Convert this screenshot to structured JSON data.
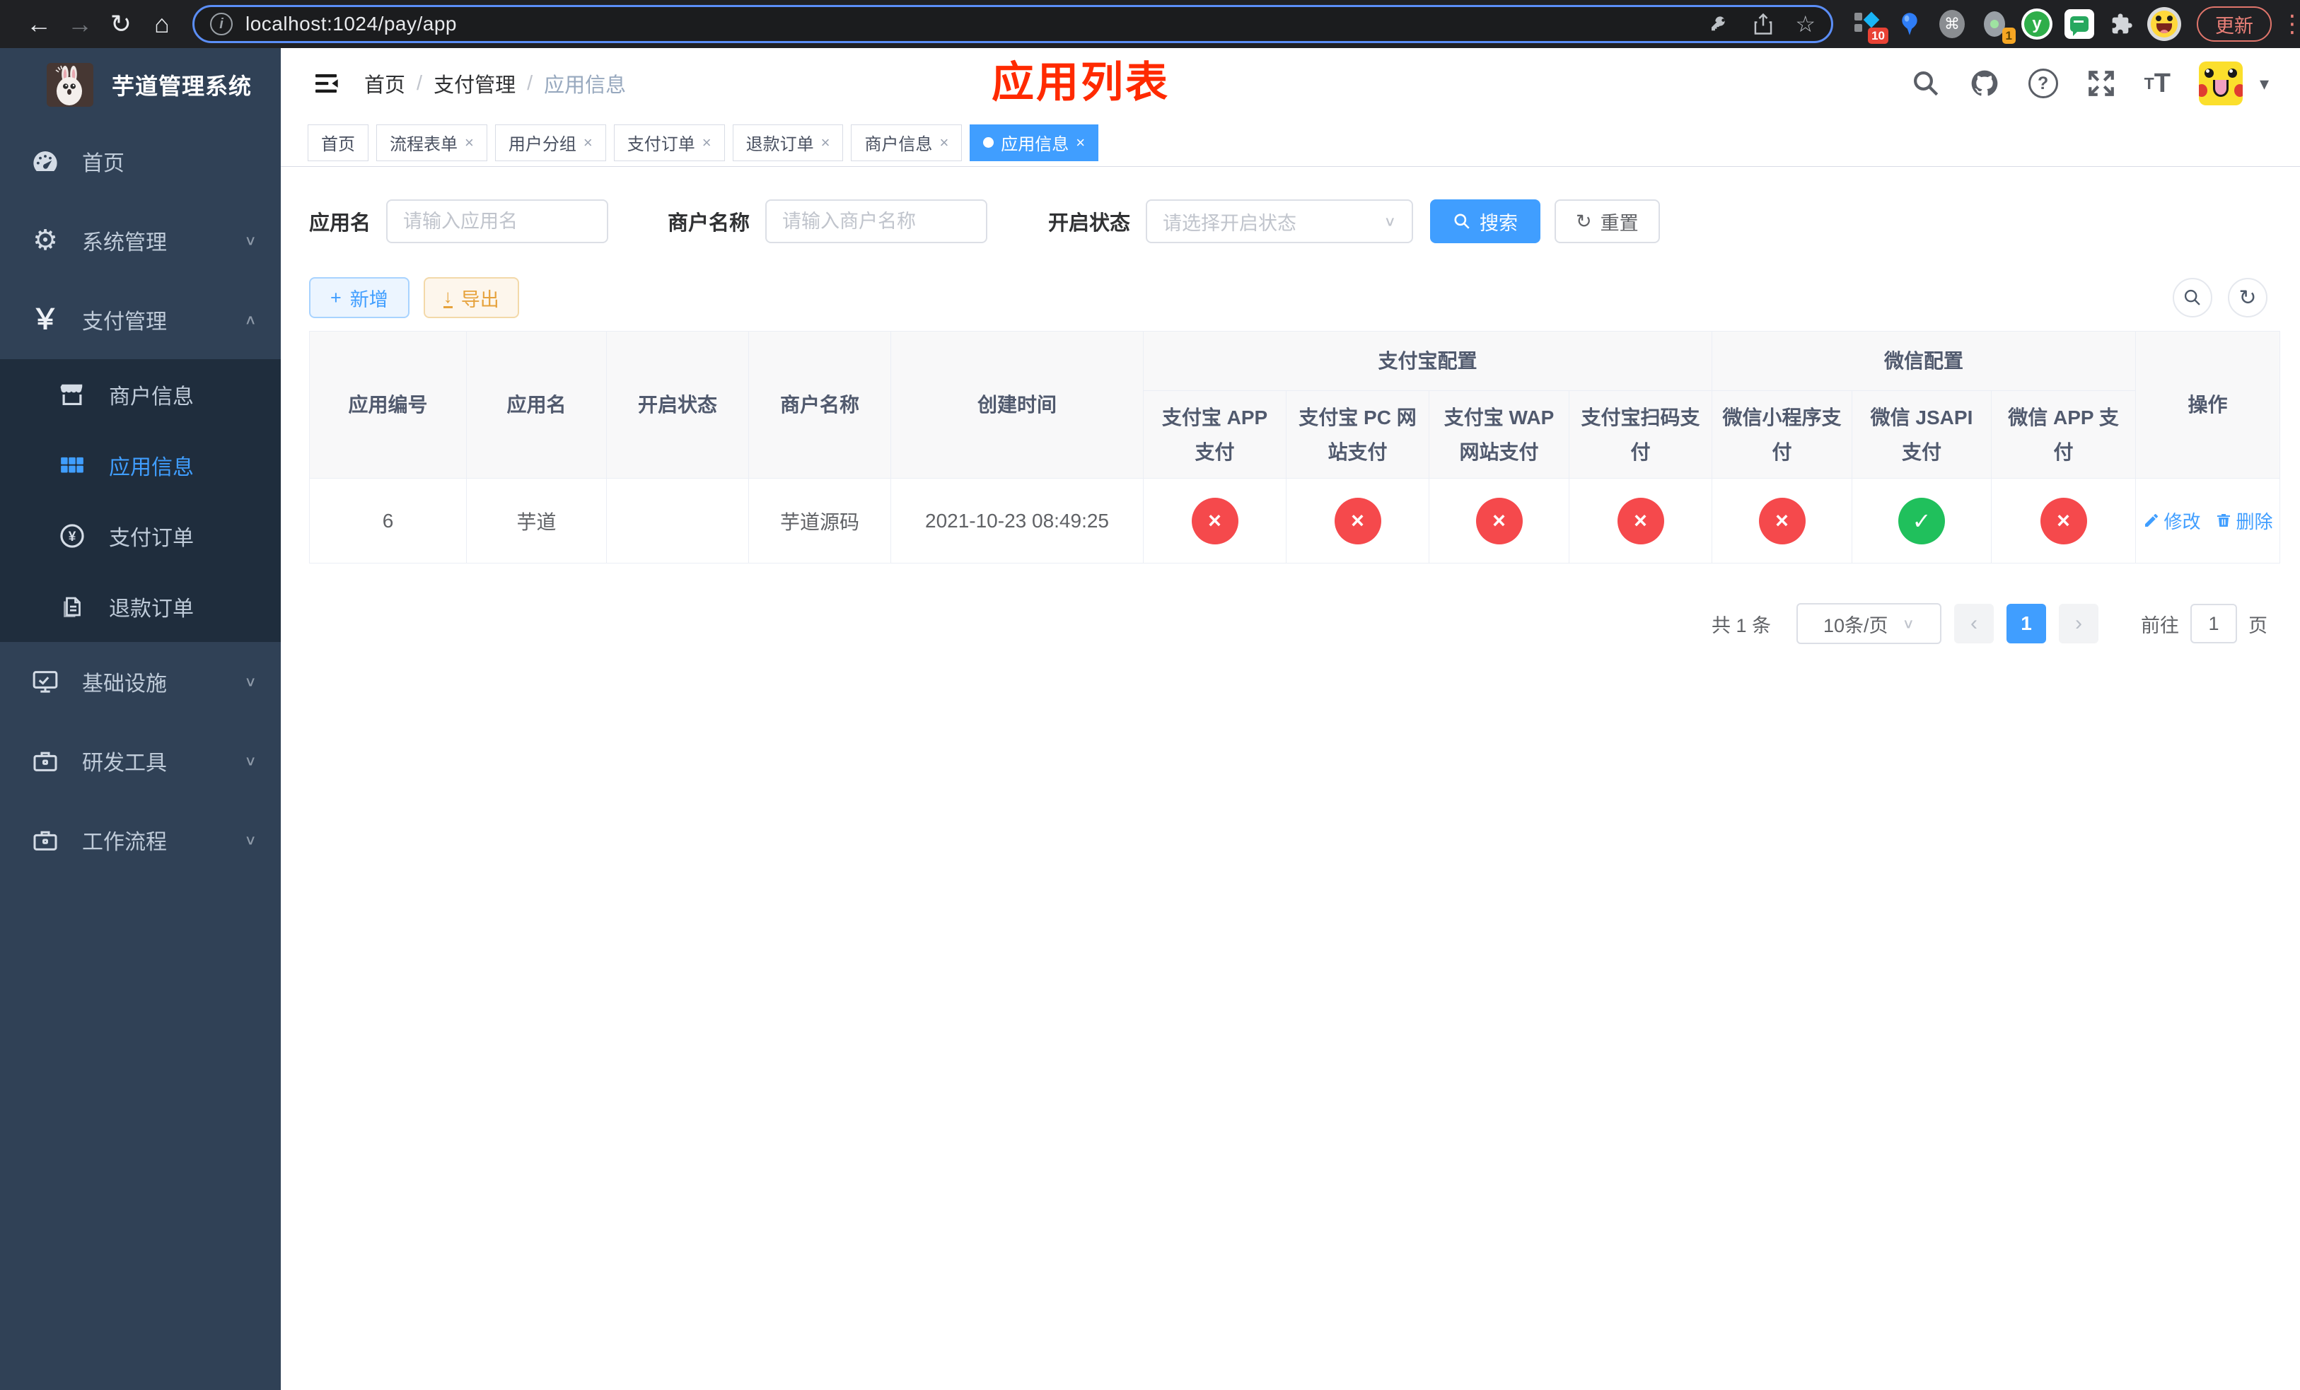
{
  "browser": {
    "url": "localhost:1024/pay/app",
    "update_button": "更新",
    "extension_badges": {
      "first": "10",
      "fourth": "1"
    }
  },
  "icons": {
    "back": "←",
    "forward": "→",
    "reload": "↻",
    "home": "⌂",
    "info": "i",
    "star": "☆",
    "command": "⌘",
    "kebab": "⋮",
    "caret_down": "▾",
    "chevron_down": "∨",
    "chevron_up": "∧",
    "breadcrumb_separator": "/",
    "yuan": "￥",
    "plus": "+",
    "download": "↓",
    "refresh": "↻",
    "check": "✓",
    "cross": "×",
    "page_prev": "‹",
    "page_next": "›",
    "help": "?",
    "font_small": "T",
    "font_large": "T",
    "y_logo": "y",
    "dot": "●"
  },
  "sidebar": {
    "title": "芋道管理系统",
    "items": [
      {
        "label": "首页",
        "icon": "dashboard-icon"
      },
      {
        "label": "系统管理",
        "icon": "gear-icon",
        "state": "collapsed"
      },
      {
        "label": "支付管理",
        "icon": "yuan-icon",
        "state": "expanded"
      },
      {
        "label": "商户信息",
        "icon": "store-icon",
        "submenu": true
      },
      {
        "label": "应用信息",
        "icon": "grid-icon",
        "submenu": true,
        "active": true
      },
      {
        "label": "支付订单",
        "icon": "yuan-circle-icon",
        "submenu": true
      },
      {
        "label": "退款订单",
        "icon": "document-icon",
        "submenu": true
      },
      {
        "label": "基础设施",
        "icon": "monitor-icon",
        "state": "collapsed"
      },
      {
        "label": "研发工具",
        "icon": "briefcase-icon",
        "state": "collapsed"
      },
      {
        "label": "工作流程",
        "icon": "briefcase-icon",
        "state": "collapsed"
      }
    ]
  },
  "header": {
    "breadcrumb": [
      "首页",
      "支付管理",
      "应用信息"
    ],
    "annotation": "应用列表"
  },
  "tabs": [
    {
      "label": "首页",
      "closable": false,
      "active": false
    },
    {
      "label": "流程表单",
      "closable": true,
      "active": false
    },
    {
      "label": "用户分组",
      "closable": true,
      "active": false
    },
    {
      "label": "支付订单",
      "closable": true,
      "active": false
    },
    {
      "label": "退款订单",
      "closable": true,
      "active": false
    },
    {
      "label": "商户信息",
      "closable": true,
      "active": false
    },
    {
      "label": "应用信息",
      "closable": true,
      "active": true
    }
  ],
  "filters": {
    "app_name": {
      "label": "应用名",
      "placeholder": "请输入应用名",
      "value": ""
    },
    "merchant_name": {
      "label": "商户名称",
      "placeholder": "请输入商户名称",
      "value": ""
    },
    "status": {
      "label": "开启状态",
      "placeholder": "请选择开启状态",
      "value": ""
    },
    "search_button": "搜索",
    "reset_button": "重置"
  },
  "toolbar": {
    "add_button": "新增",
    "export_button": "导出"
  },
  "table": {
    "plain_columns": [
      "应用编号",
      "应用名",
      "开启状态",
      "商户名称",
      "创建时间"
    ],
    "alipay_group": "支付宝配置",
    "wechat_group": "微信配置",
    "alipay_columns": [
      "支付宝 APP 支付",
      "支付宝 PC 网站支付",
      "支付宝 WAP 网站支付",
      "支付宝扫码支付"
    ],
    "wechat_columns": [
      "微信小程序支付",
      "微信 JSAPI 支付",
      "微信 APP 支付"
    ],
    "action_column": "操作",
    "rows": [
      {
        "id": "6",
        "name": "芋道",
        "enabled": true,
        "merchant": "芋道源码",
        "created": "2021-10-23 08:49:25",
        "configs": [
          false,
          false,
          false,
          false,
          false,
          true,
          false
        ],
        "edit_label": "修改",
        "delete_label": "删除"
      }
    ]
  },
  "pagination": {
    "total": "共 1 条",
    "page_size": "10条/页",
    "current_page": "1",
    "goto_label": "前往",
    "goto_value": "1",
    "unit_label": "页"
  },
  "colors": {
    "primary": "#409eff",
    "success": "#20c05c",
    "danger": "#f5494c",
    "warning": "#e6a23c",
    "sidebar_bg": "#304156",
    "submenu_bg": "#1f2d3d",
    "annotation_red": "#ff2a00"
  }
}
